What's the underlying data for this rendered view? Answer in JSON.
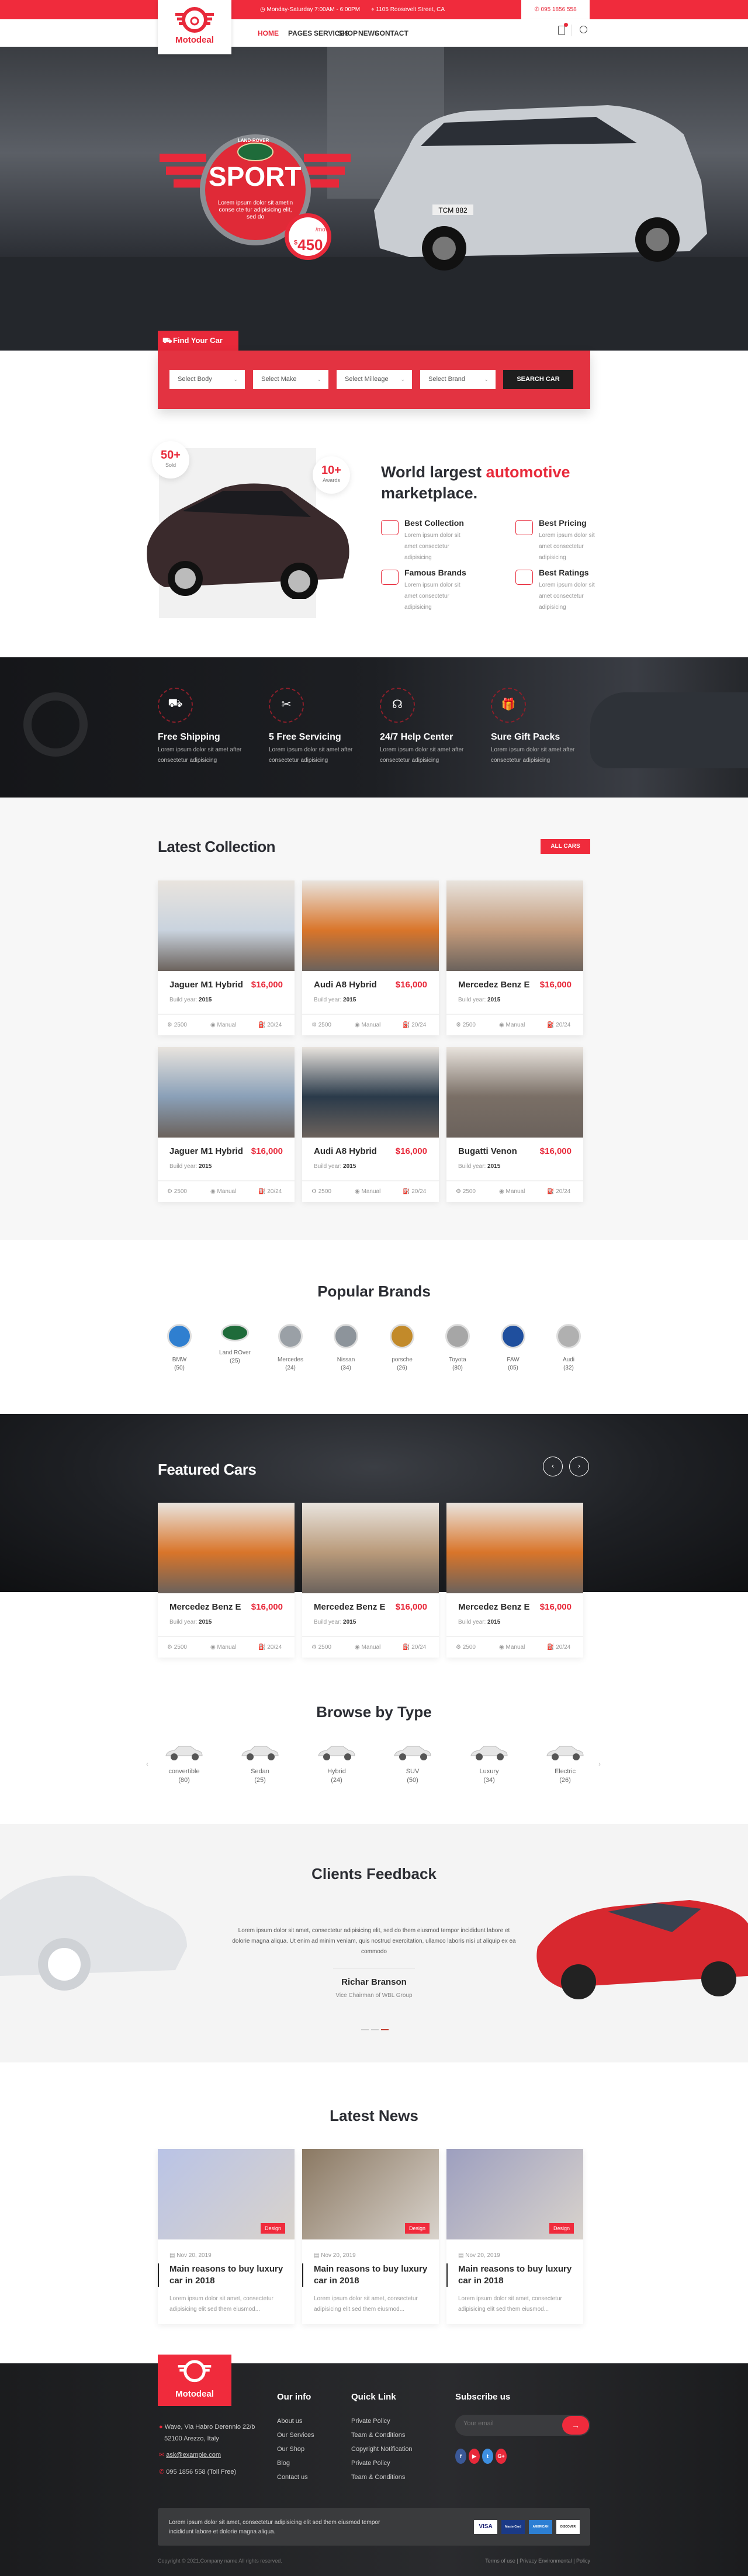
{
  "colors": {
    "accent": "#e8293a",
    "dark": "#1e1e1e",
    "footer": "#1d1e20"
  },
  "brand": {
    "name": "Motodeal"
  },
  "topbar": {
    "hours": "Monday-Saturday 7:00AM - 6:00PM",
    "address": "1105 Roosevelt Street, CA",
    "phone": "095 1856 558"
  },
  "nav": {
    "items": [
      "HOME",
      "PAGES",
      "SERVICES",
      "SHOP",
      "NEWS",
      "CONTACT"
    ],
    "active": "HOME"
  },
  "hero": {
    "badge_brand": "LAND-ROVER",
    "title": "SPORT",
    "text": "Lorem ipsum dolor sit ametin conse cte tur adipisicing elit, sed do",
    "price": "450",
    "currency": "$",
    "per": "/mo",
    "plate": "TCM 882"
  },
  "finder": {
    "tab": "Find Your Car",
    "selects": [
      "Select Body",
      "Select Make",
      "Select Milleage",
      "Select Brand"
    ],
    "button": "SEARCH CAR"
  },
  "about": {
    "stat1": {
      "value": "50+",
      "label": "Sold"
    },
    "stat2": {
      "value": "10+",
      "label": "Awards"
    },
    "heading_a": "World largest ",
    "heading_b": "automotive",
    "heading_c": "marketplace.",
    "features": [
      {
        "title": "Best Collection",
        "desc": "Lorem ipsum dolor sit amet consectetur adipisicing",
        "icon": "car-icon"
      },
      {
        "title": "Best Pricing",
        "desc": "Lorem ipsum dolor sit amet consectetur adipisicing",
        "icon": "dollar-hand-icon"
      },
      {
        "title": "Famous Brands",
        "desc": "Lorem ipsum dolor sit amet consectetur adipisicing",
        "icon": "car-badge-icon"
      },
      {
        "title": "Best Ratings",
        "desc": "Lorem ipsum dolor sit amet consectetur adipisicing",
        "icon": "stars-hand-icon"
      }
    ]
  },
  "services": [
    {
      "title": "Free Shipping",
      "desc": "Lorem ipsum dolor sit amet after consectetur adipisicing",
      "icon": "truck-icon"
    },
    {
      "title": "5 Free Servicing",
      "desc": "Lorem ipsum dolor sit amet after consectetur adipisicing",
      "icon": "tools-icon"
    },
    {
      "title": "24/7 Help Center",
      "desc": "Lorem ipsum dolor sit amet after consectetur adipisicing",
      "icon": "headset-icon"
    },
    {
      "title": "Sure Gift Packs",
      "desc": "Lorem ipsum dolor sit amet after consectetur adipisicing",
      "icon": "gift-icon"
    }
  ],
  "collection": {
    "title": "Latest Collection",
    "all_button": "ALL CARS",
    "build_label": "Build year:",
    "cars": [
      {
        "name": "Jaguer M1 Hybrid",
        "price": "$16,000",
        "year": "2015",
        "engine": "2500",
        "gear": "Manual",
        "mpg": "20/24",
        "color": "#c9d3de"
      },
      {
        "name": "Audi A8 Hybrid",
        "price": "$16,000",
        "year": "2015",
        "engine": "2500",
        "gear": "Manual",
        "mpg": "20/24",
        "color": "#d9752a"
      },
      {
        "name": "Mercedez Benz E",
        "price": "$16,000",
        "year": "2015",
        "engine": "2500",
        "gear": "Manual",
        "mpg": "20/24",
        "color": "#c39a7a"
      },
      {
        "name": "Jaguer M1 Hybrid",
        "price": "$16,000",
        "year": "2015",
        "engine": "2500",
        "gear": "Manual",
        "mpg": "20/24",
        "color": "#8aa0b8"
      },
      {
        "name": "Audi A8 Hybrid",
        "price": "$16,000",
        "year": "2015",
        "engine": "2500",
        "gear": "Manual",
        "mpg": "20/24",
        "color": "#2a3a4a"
      },
      {
        "name": "Bugatti Venon",
        "price": "$16,000",
        "year": "2015",
        "engine": "2500",
        "gear": "Manual",
        "mpg": "20/24",
        "color": "#7a6f66"
      }
    ]
  },
  "brands": {
    "title": "Popular Brands",
    "items": [
      {
        "name": "BMW",
        "count": "(50)",
        "color": "#2f7fd0"
      },
      {
        "name": "Land ROver",
        "count": "(25)",
        "color": "#1f6b3a"
      },
      {
        "name": "Mercedes",
        "count": "(24)",
        "color": "#9aa0a6"
      },
      {
        "name": "Nissan",
        "count": "(34)",
        "color": "#8d949b"
      },
      {
        "name": "porsche",
        "count": "(26)",
        "color": "#c28a2a"
      },
      {
        "name": "Toyota",
        "count": "(80)",
        "color": "#a6a6a6"
      },
      {
        "name": "FAW",
        "count": "(05)",
        "color": "#1f4f9e"
      },
      {
        "name": "Audi",
        "count": "(32)",
        "color": "#b0b0b0"
      }
    ]
  },
  "featured": {
    "title": "Featured Cars",
    "build_label": "Build year:",
    "cars": [
      {
        "name": "Mercedez Benz E",
        "price": "$16,000",
        "year": "2015",
        "engine": "2500",
        "gear": "Manual",
        "mpg": "20/24",
        "color": "#d9752a"
      },
      {
        "name": "Mercedez Benz E",
        "price": "$16,000",
        "year": "2015",
        "engine": "2500",
        "gear": "Manual",
        "mpg": "20/24",
        "color": "#b99a7a"
      },
      {
        "name": "Mercedez Benz E",
        "price": "$16,000",
        "year": "2015",
        "engine": "2500",
        "gear": "Manual",
        "mpg": "20/24",
        "color": "#d9752a"
      }
    ]
  },
  "types": {
    "title": "Browse by Type",
    "items": [
      {
        "name": "convertible",
        "count": "(80)"
      },
      {
        "name": "Sedan",
        "count": "(25)"
      },
      {
        "name": "Hybrid",
        "count": "(24)"
      },
      {
        "name": "SUV",
        "count": "(50)"
      },
      {
        "name": "Luxury",
        "count": "(34)"
      },
      {
        "name": "Electric",
        "count": "(26)"
      }
    ]
  },
  "feedback": {
    "title": "Clients Feedback",
    "quote": "Lorem ipsum dolor sit amet, consectetur adipisicing elit, sed do them eiusmod tempor incididunt labore et dolorie magna aliqua. Ut enim ad minim veniam, quis nostrud exercitation, ullamco laboris nisi ut aliquip ex ea commodo",
    "name": "Richar Branson",
    "role": "Vice Chairman of WBL Group",
    "active_dot": 3
  },
  "news": {
    "title": "Latest News",
    "items": [
      {
        "tag": "Design",
        "date": "Nov 20, 2019",
        "title": "Main reasons to buy luxury car in 2018",
        "desc": "Lorem ipsum dolor sit amet, consectetur adipisicing elit sed them eiusmod...",
        "color": "#b9c3e6"
      },
      {
        "tag": "Design",
        "date": "Nov 20, 2019",
        "title": "Main reasons to buy luxury car in 2018",
        "desc": "Lorem ipsum dolor sit amet, consectetur adipisicing elit sed them eiusmod...",
        "color": "#8a7862"
      },
      {
        "tag": "Design",
        "date": "Nov 20, 2019",
        "title": "Main reasons to buy luxury car in 2018",
        "desc": "Lorem ipsum dolor sit amet, consectetur adipisicing elit sed them eiusmod...",
        "color": "#9d9fbf"
      }
    ]
  },
  "footer": {
    "address1": "Wave, Via Habro Derennio 22/b",
    "address2": "52100 Arezzo, Italy",
    "email": "ask@example.com",
    "phone": "095 1856 558 (Toll Free)",
    "info_title": "Our info",
    "info_links": [
      "About us",
      "Our Services",
      "Our Shop",
      "Blog",
      "Contact us"
    ],
    "quick_title": "Quick Link",
    "quick_links": [
      "Private Policy",
      "Team & Conditions",
      "Copyright Notification",
      "Private Policy",
      "Team & Conditions"
    ],
    "subscribe_title": "Subscribe us",
    "email_placeholder": "Your email",
    "socials": [
      {
        "icon": "facebook-icon",
        "glyph": "f",
        "color": "#3b5998"
      },
      {
        "icon": "youtube-icon",
        "glyph": "▶",
        "color": "#e8293a"
      },
      {
        "icon": "twitter-icon",
        "glyph": "t",
        "color": "#3d8fe0"
      },
      {
        "icon": "google-plus-icon",
        "glyph": "G+",
        "color": "#e8293a"
      }
    ],
    "strip_text": "Lorem ipsum dolor sit amet, consectetur adipisicing elit sed them eiusmod tempor incididunt labore et dolorie magna aliqua.",
    "payments": [
      "VISA",
      "MasterCard",
      "AMERICAN EXPRESS",
      "DISCOVER"
    ],
    "copyright": "Copyright © 2021.Company name All rights reserved.",
    "legal": [
      "Terms of use",
      "Privacy Environmental",
      "Policy"
    ]
  }
}
